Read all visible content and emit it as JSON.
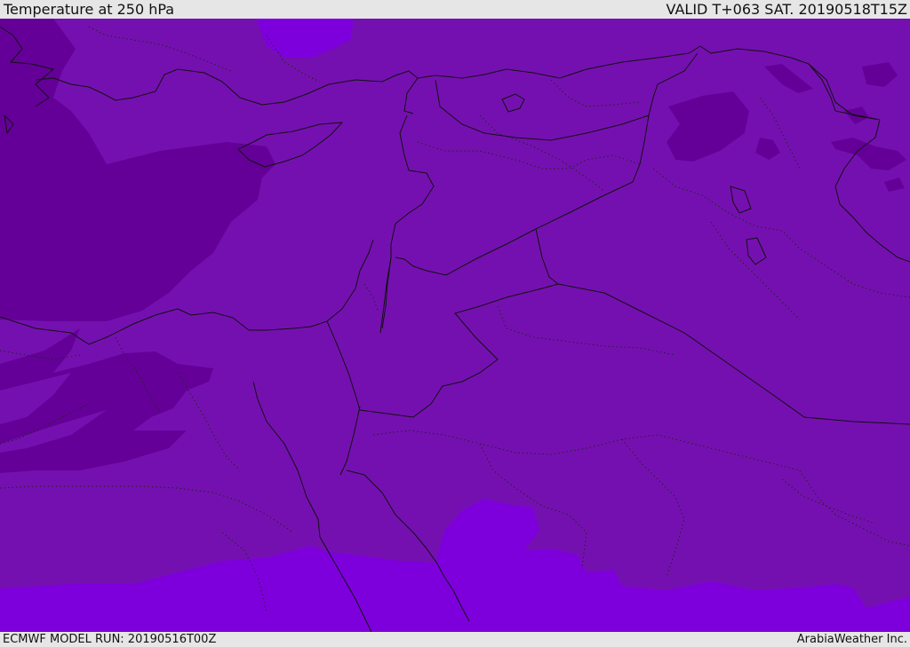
{
  "header": {
    "title": "Temperature at 250 hPa",
    "valid": "VALID T+063 SAT. 20190518T15Z"
  },
  "footer": {
    "model_run": "ECMWF MODEL RUN: 20190516T00Z",
    "credit": "ArabiaWeather Inc."
  },
  "map": {
    "colors": {
      "background_mid": "#7510b0",
      "colder_band": "#640098",
      "warmer_band": "#7d00dc",
      "coastline": "#111111"
    }
  }
}
